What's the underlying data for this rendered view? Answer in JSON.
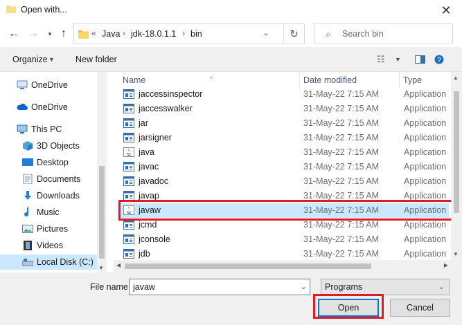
{
  "window": {
    "title": "Open with..."
  },
  "address": {
    "overflow": "«",
    "crumbs": [
      "Java",
      "jdk-18.0.1.1",
      "bin"
    ]
  },
  "search": {
    "placeholder": "Search bin"
  },
  "toolbar": {
    "organize": "Organize",
    "new_folder": "New folder"
  },
  "sidebar": {
    "items": [
      {
        "label": "OneDrive",
        "icon": "computer-icon"
      },
      {
        "label": "OneDrive",
        "icon": "cloud-icon"
      },
      {
        "label": "This PC",
        "icon": "pc-icon"
      },
      {
        "label": "3D Objects",
        "icon": "cube-icon"
      },
      {
        "label": "Desktop",
        "icon": "desktop-icon"
      },
      {
        "label": "Documents",
        "icon": "documents-icon"
      },
      {
        "label": "Downloads",
        "icon": "download-icon"
      },
      {
        "label": "Music",
        "icon": "music-icon"
      },
      {
        "label": "Pictures",
        "icon": "pictures-icon"
      },
      {
        "label": "Videos",
        "icon": "videos-icon"
      },
      {
        "label": "Local Disk (C:)",
        "icon": "drive-icon"
      }
    ]
  },
  "filelist": {
    "columns": [
      "Name",
      "Date modified",
      "Type"
    ],
    "rows": [
      {
        "name": "jaccessinspector",
        "date": "31-May-22 7:15 AM",
        "type": "Application",
        "icon": "app-icon"
      },
      {
        "name": "jaccesswalker",
        "date": "31-May-22 7:15 AM",
        "type": "Application",
        "icon": "app-icon"
      },
      {
        "name": "jar",
        "date": "31-May-22 7:15 AM",
        "type": "Application",
        "icon": "app-icon"
      },
      {
        "name": "jarsigner",
        "date": "31-May-22 7:15 AM",
        "type": "Application",
        "icon": "app-icon"
      },
      {
        "name": "java",
        "date": "31-May-22 7:15 AM",
        "type": "Application",
        "icon": "java-icon"
      },
      {
        "name": "javac",
        "date": "31-May-22 7:15 AM",
        "type": "Application",
        "icon": "app-icon"
      },
      {
        "name": "javadoc",
        "date": "31-May-22 7:15 AM",
        "type": "Application",
        "icon": "app-icon"
      },
      {
        "name": "javap",
        "date": "31-May-22 7:15 AM",
        "type": "Application",
        "icon": "app-icon"
      },
      {
        "name": "javaw",
        "date": "31-May-22 7:15 AM",
        "type": "Application",
        "icon": "java-icon"
      },
      {
        "name": "jcmd",
        "date": "31-May-22 7:15 AM",
        "type": "Application",
        "icon": "app-icon"
      },
      {
        "name": "jconsole",
        "date": "31-May-22 7:15 AM",
        "type": "Application",
        "icon": "app-icon"
      },
      {
        "name": "jdb",
        "date": "31-May-22 7:15 AM",
        "type": "Application",
        "icon": "app-icon"
      }
    ]
  },
  "bottom": {
    "file_name_label": "File name:",
    "file_name_value": "javaw",
    "filter_value": "Programs",
    "open_label": "Open",
    "cancel_label": "Cancel"
  },
  "colors": {
    "selection": "#cce8ff",
    "highlight": "#e21b22",
    "accent": "#0078d7"
  }
}
